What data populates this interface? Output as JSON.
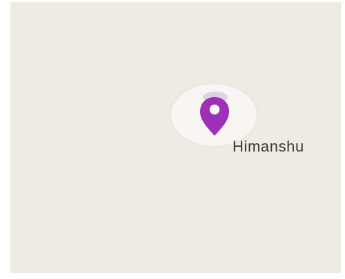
{
  "map": {
    "background_color": "#eeebe4",
    "place": {
      "label": "Himanshu",
      "icon": "location-pin-icon",
      "pin_color": "#9e2fb8"
    }
  }
}
